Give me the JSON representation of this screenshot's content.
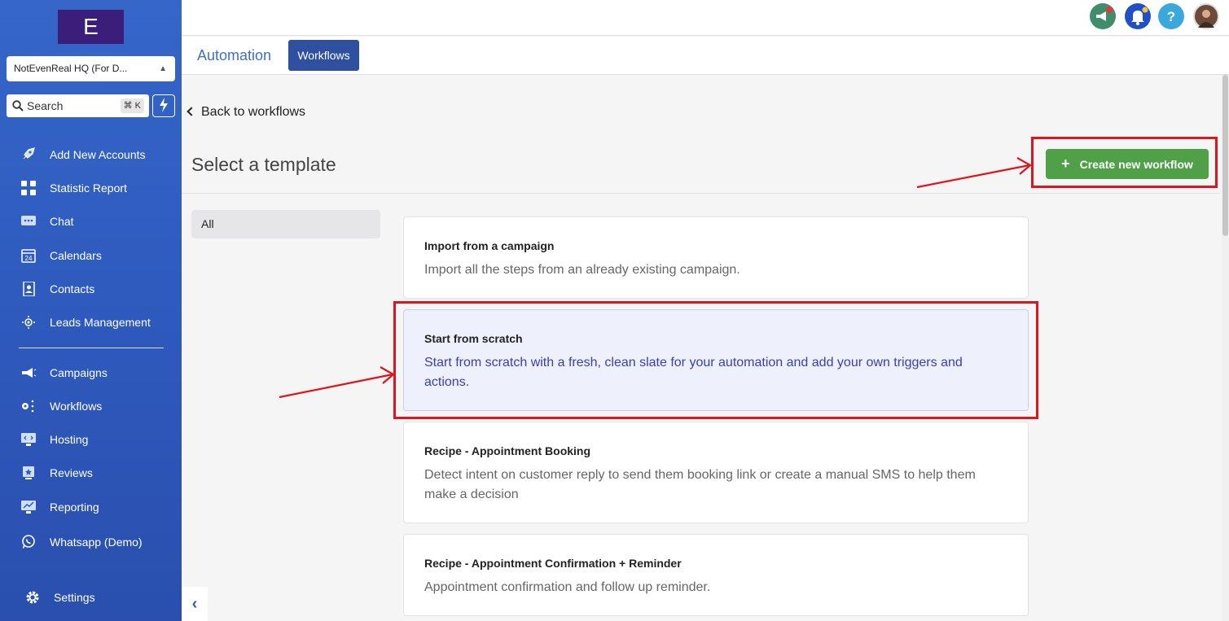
{
  "sidebar": {
    "logo_letter": "E",
    "account": "NotEvenReal HQ (For D...",
    "search_label": "Search",
    "search_shortcut": "⌘ K",
    "items": [
      {
        "label": "Add New Accounts",
        "icon": "rocket-icon"
      },
      {
        "label": "Statistic Report",
        "icon": "grid-icon"
      },
      {
        "label": "Chat",
        "icon": "chat-icon"
      },
      {
        "label": "Calendars",
        "icon": "calendar-icon"
      },
      {
        "label": "Contacts",
        "icon": "contacts-icon"
      },
      {
        "label": "Leads Management",
        "icon": "leads-icon"
      },
      {
        "label": "Campaigns",
        "icon": "megaphone-icon"
      },
      {
        "label": "Workflows",
        "icon": "workflow-icon"
      },
      {
        "label": "Hosting",
        "icon": "hosting-icon"
      },
      {
        "label": "Reviews",
        "icon": "reviews-icon"
      },
      {
        "label": "Reporting",
        "icon": "reporting-icon"
      },
      {
        "label": "Whatsapp (Demo)",
        "icon": "whatsapp-icon"
      },
      {
        "label": "Settings",
        "icon": "gear-icon"
      }
    ]
  },
  "tabs": {
    "automation": "Automation",
    "workflows": "Workflows"
  },
  "main": {
    "back_label": "Back to workflows",
    "title": "Select a template",
    "create_button": "Create new workflow",
    "filter_all": "All",
    "templates": [
      {
        "title": "Import from a campaign",
        "description": "Import all the steps from an already existing campaign."
      },
      {
        "title": "Start from scratch",
        "description": "Start from scratch with a fresh, clean slate for your automation and add your own triggers and actions."
      },
      {
        "title": "Recipe - Appointment Booking",
        "description": "Detect intent on customer reply to send them booking link or create a manual SMS to help them make a decision"
      },
      {
        "title": "Recipe - Appointment Confirmation + Reminder",
        "description": "Appointment confirmation and follow up reminder."
      }
    ]
  },
  "colors": {
    "sidebar": "#2f5bbf",
    "accent_green": "#4fa046",
    "annotation_red": "#e0141c",
    "selected_card": "#eef0fb"
  }
}
